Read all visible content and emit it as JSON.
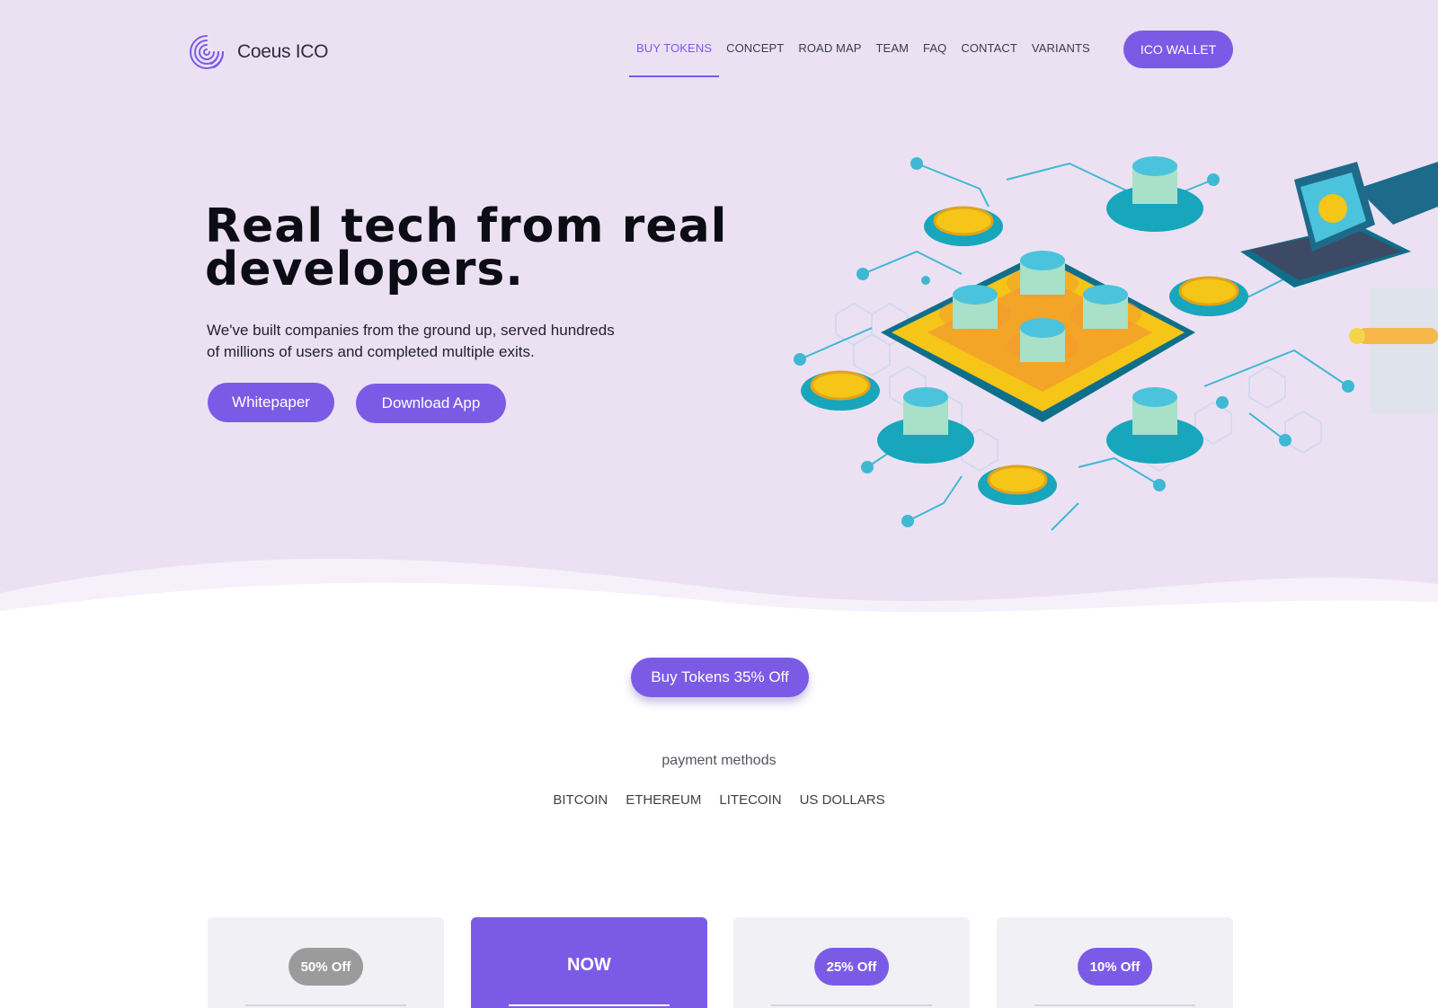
{
  "brand": {
    "name": "Coeus ICO",
    "accent": "#7b5be6",
    "hero_bg": "#ece1f3"
  },
  "nav": {
    "items": [
      {
        "label": "BUY TOKENS",
        "active": true
      },
      {
        "label": "CONCEPT"
      },
      {
        "label": "ROAD MAP"
      },
      {
        "label": "TEAM"
      },
      {
        "label": "FAQ"
      },
      {
        "label": "CONTACT"
      },
      {
        "label": "VARIANTS"
      }
    ],
    "wallet_button": "ICO WALLET"
  },
  "hero": {
    "headline_line1": "Real tech from real",
    "headline_line2": "developers.",
    "subtext_line1": "We've built companies from the ground up, served hundreds",
    "subtext_line2": "of millions of users and completed multiple exits.",
    "whitepaper_button": "Whitepaper",
    "download_button": "Download App",
    "illustration": "isometric-blockchain-network-illustration"
  },
  "buy": {
    "button": "Buy Tokens 35% Off",
    "payment_title": "payment methods",
    "payment_methods": [
      "BITCOIN",
      "ETHEREUM",
      "LITECOIN",
      "US DOLLARS"
    ]
  },
  "cards": [
    {
      "label": "50% Off",
      "style": "grey"
    },
    {
      "label": "NOW",
      "style": "highlight"
    },
    {
      "label": "25% Off",
      "style": "accent"
    },
    {
      "label": "10% Off",
      "style": "accent"
    }
  ]
}
